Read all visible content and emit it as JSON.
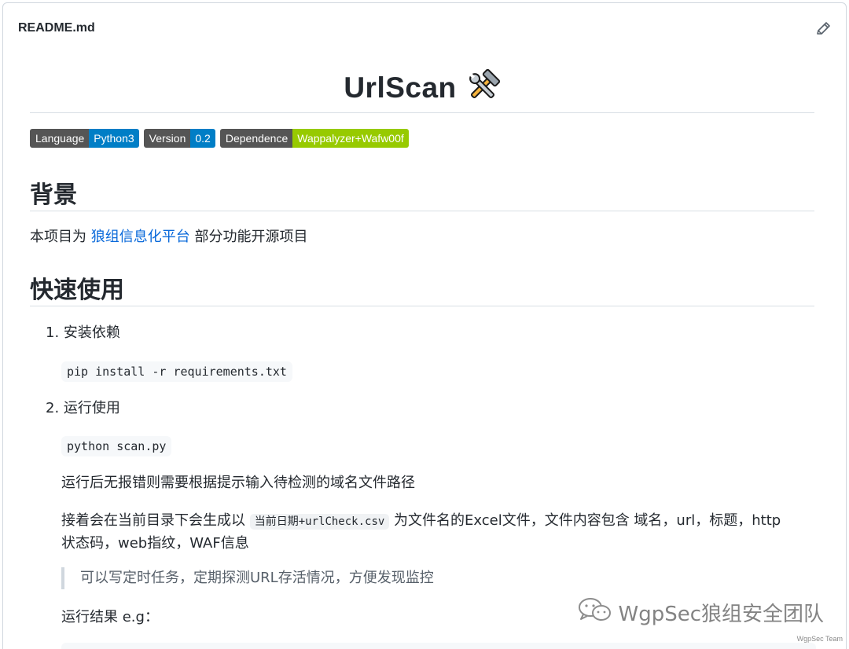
{
  "header": {
    "file_name": "README.md"
  },
  "readme": {
    "title": "UrlScan",
    "badges": [
      {
        "key": "Language",
        "value": "Python3",
        "color": "#007ec6"
      },
      {
        "key": "Version",
        "value": "0.2",
        "color": "#007ec6"
      },
      {
        "key": "Dependence",
        "value": "Wappalyzer+Wafw00f",
        "color": "#97ca00"
      }
    ],
    "background_heading": "背景",
    "background_text_prefix": "本项目为 ",
    "background_link": "狼组信息化平台",
    "background_text_suffix": " 部分功能开源项目",
    "quick_heading": "快速使用",
    "step1_label": "1. 安装依赖",
    "step1_code": "pip install -r requirements.txt",
    "step2_label": "2. 运行使用",
    "step2_code": "python scan.py",
    "run_note": "运行后无报错则需要根据提示输入待检测的域名文件路径",
    "output_prefix": "接着会在当前目录下会生成以 ",
    "output_code": "当前日期+urlCheck.csv",
    "output_suffix": " 为文件名的Excel文件，文件内容包含 域名，url，标题，http",
    "output_line2": "状态码，web指纹，WAF信息",
    "quote": "可以写定时任务，定期探测URL存活情况，方便发现监控",
    "result_label": "运行结果 e.g："
  },
  "watermark": {
    "text": "WgpSec狼组安全团队",
    "sub": "WgpSec Team"
  },
  "icons": {
    "edit": "pencil-icon",
    "title_emoji": "hammer-wrench-icon",
    "watermark": "wechat-icon"
  }
}
